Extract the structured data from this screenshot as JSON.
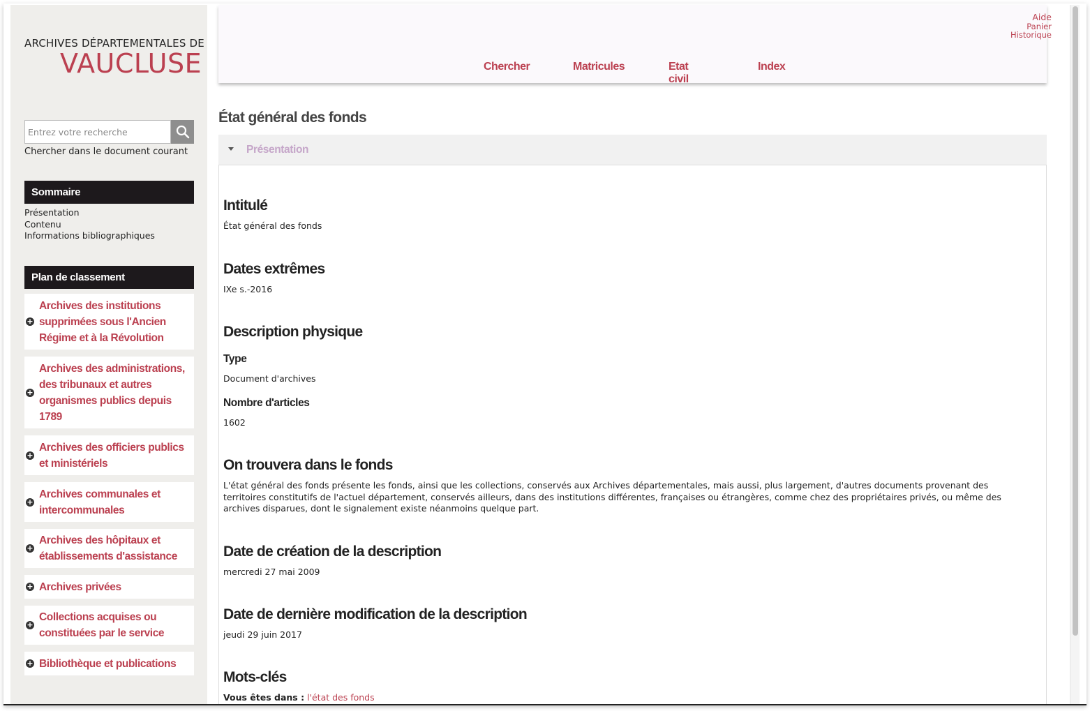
{
  "logo": {
    "line1": "ARCHIVES DÉPARTEMENTALES DE",
    "line2": "VAUCLUSE"
  },
  "search": {
    "placeholder": "Entrez votre recherche",
    "hint": "Chercher dans le document courant"
  },
  "sommaire": {
    "title": "Sommaire",
    "items": [
      "Présentation",
      "Contenu",
      "Informations bibliographiques"
    ]
  },
  "plan": {
    "title": "Plan de classement",
    "items": [
      "Archives des institutions supprimées sous l'Ancien Régime et à la Révolution",
      "Archives des administrations, des tribunaux et autres organismes publics depuis 1789",
      "Archives des officiers publics et ministériels",
      "Archives communales et intercommunales",
      "Archives des hôpitaux et établissements d'assistance",
      "Archives privées",
      "Collections acquises ou constituées par le service",
      "Bibliothèque et publications"
    ]
  },
  "top_links": [
    "Aide",
    "Panier",
    "Historique"
  ],
  "nav": [
    "Chercher",
    "Matricules",
    "Etat civil",
    "Index"
  ],
  "page_title": "État général des fonds",
  "accordion": {
    "label": "Présentation"
  },
  "content": {
    "intitule": {
      "heading": "Intitulé",
      "value": "État général des fonds"
    },
    "dates": {
      "heading": "Dates extrêmes",
      "value": "IXe s.-2016"
    },
    "description": {
      "heading": "Description physique",
      "type_label": "Type",
      "type_value": "Document d'archives",
      "nombre_label": "Nombre d'articles",
      "nombre_value": "1602"
    },
    "trouvera": {
      "heading": "On trouvera dans le fonds",
      "value": "L'état général des fonds présente les fonds, ainsi que les collections, conservés aux Archives départementales, mais aussi, plus largement, d'autres documents provenant des territoires constitutifs de l'actuel département, conservés ailleurs, dans des institutions différentes, françaises ou étrangères, comme chez des propriétaires privés, ou même des archives disparues, dont le signalement existe néanmoins quelque part."
    },
    "creation": {
      "heading": "Date de création de la description",
      "value": "mercredi 27 mai 2009"
    },
    "modification": {
      "heading": "Date de dernière modification de la description",
      "value": "jeudi 29 juin 2017"
    },
    "mots_cles": {
      "heading": "Mots-clés",
      "breadcrumb_label": "Vous êtes dans :",
      "breadcrumb_link": "l'état des fonds"
    }
  },
  "colors": {
    "accent": "#bb4050",
    "sidebar_bg": "#efeeeb",
    "section_head_bg": "#1d191c",
    "accordion_label": "#c5a6c9"
  },
  "icons": [
    "search-icon",
    "plus-circle-icon",
    "caret-down-icon"
  ]
}
